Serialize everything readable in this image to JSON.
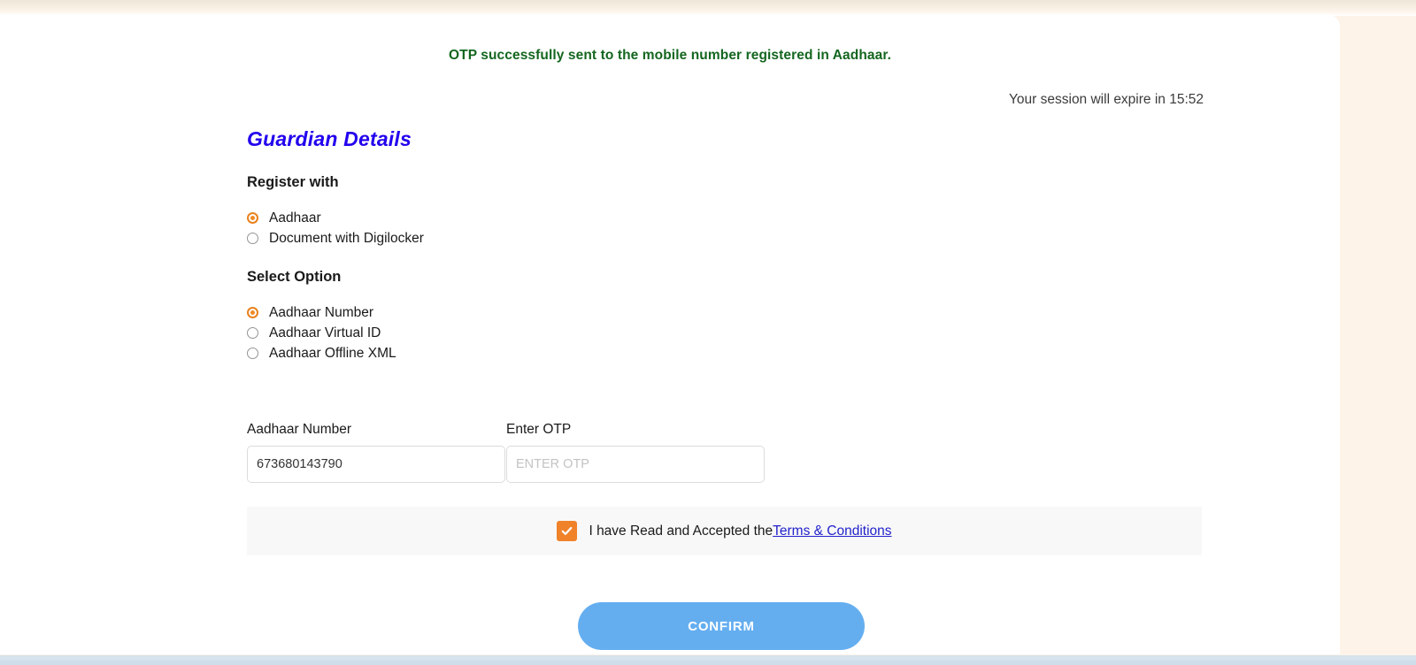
{
  "alert": {
    "message": "OTP successfully sent to the mobile number registered in Aadhaar.",
    "color": "#14661f"
  },
  "session": {
    "text": "Your session will expire in 15:52"
  },
  "page_title": "Guardian Details",
  "register_with": {
    "label": "Register with",
    "options": [
      {
        "label": "Aadhaar",
        "selected": true
      },
      {
        "label": "Document with Digilocker",
        "selected": false
      }
    ]
  },
  "select_option": {
    "label": "Select Option",
    "options": [
      {
        "label": "Aadhaar Number",
        "selected": true
      },
      {
        "label": "Aadhaar Virtual ID",
        "selected": false
      },
      {
        "label": "Aadhaar Offline XML",
        "selected": false
      }
    ]
  },
  "fields": {
    "aadhaar": {
      "label": "Aadhaar Number",
      "value": "673680143790",
      "placeholder": ""
    },
    "otp": {
      "label": "Enter OTP",
      "value": "",
      "placeholder": "ENTER OTP"
    }
  },
  "terms": {
    "checked": true,
    "text": "I have Read and Accepted the ",
    "link_label": "Terms & Conditions",
    "checkbox_color": "#f0822a",
    "link_color": "#2222cc"
  },
  "confirm_button": {
    "label": "CONFIRM",
    "color": "#64aef0"
  },
  "theme": {
    "page_background": "#fdf3e8",
    "card_background": "#ffffff",
    "accent_orange": "#f0822a",
    "title_blue": "#2200ee",
    "bottom_bar": "#d6e2ec"
  }
}
